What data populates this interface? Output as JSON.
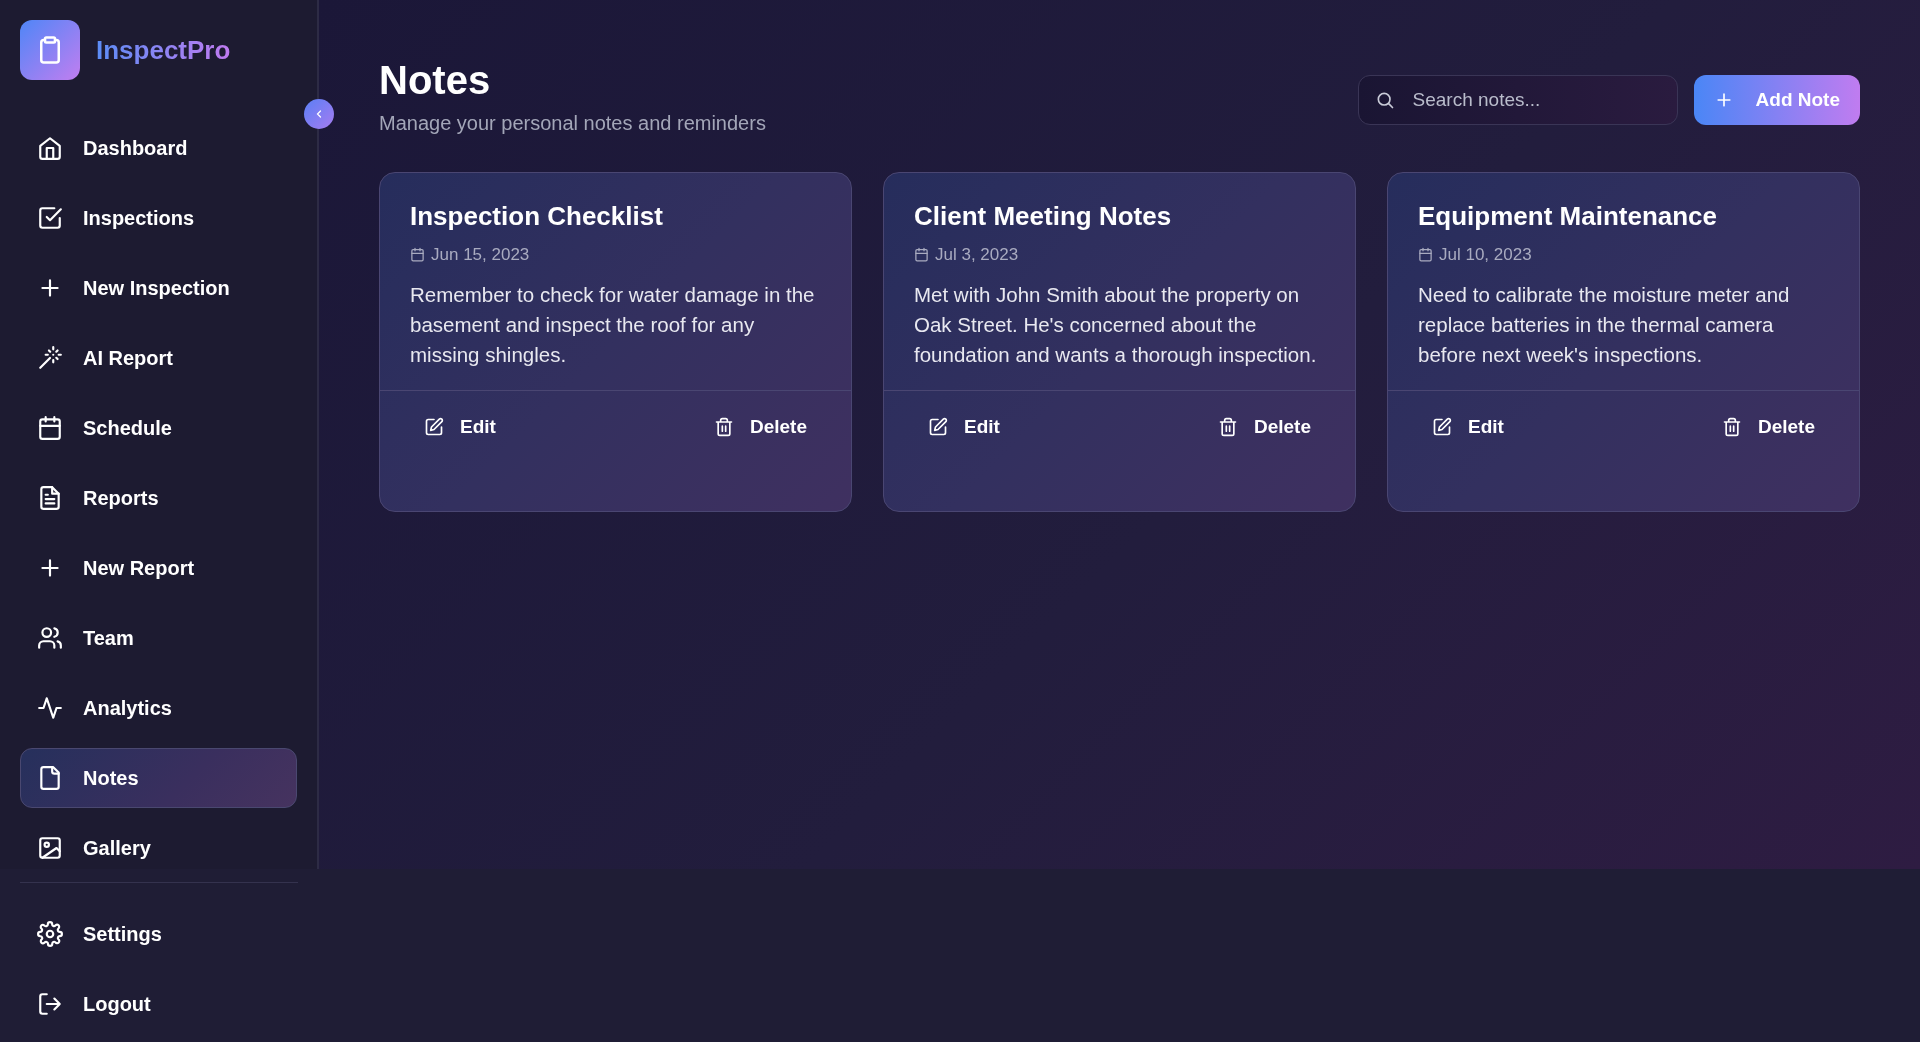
{
  "brand": {
    "name": "InspectPro"
  },
  "sidebar": {
    "items": [
      {
        "label": "Dashboard",
        "selected": false
      },
      {
        "label": "Inspections",
        "selected": false
      },
      {
        "label": "New Inspection",
        "selected": false
      },
      {
        "label": "AI Report",
        "selected": false
      },
      {
        "label": "Schedule",
        "selected": false
      },
      {
        "label": "Reports",
        "selected": false
      },
      {
        "label": "New Report",
        "selected": false
      },
      {
        "label": "Team",
        "selected": false
      },
      {
        "label": "Analytics",
        "selected": false
      },
      {
        "label": "Notes",
        "selected": true
      },
      {
        "label": "Gallery",
        "selected": false
      }
    ],
    "footer_items": [
      {
        "label": "Settings"
      },
      {
        "label": "Logout"
      }
    ]
  },
  "header": {
    "title": "Notes",
    "subtitle": "Manage your personal notes and reminders",
    "search": {
      "placeholder": "Search notes..."
    },
    "add_button": "Add Note"
  },
  "notes": [
    {
      "title": "Inspection Checklist",
      "date": "Jun 15, 2023",
      "body": "Remember to check for water damage in the basement and inspect the roof for any missing shingles.",
      "actions": [
        "Edit",
        "Delete"
      ]
    },
    {
      "title": "Client Meeting Notes",
      "date": "Jul 3, 2023",
      "body": "Met with John Smith about the property on Oak Street. He's concerned about the foundation and wants a thorough inspection.",
      "actions": [
        "Edit",
        "Delete"
      ]
    },
    {
      "title": "Equipment Maintenance",
      "date": "Jul 10, 2023",
      "body": "Need to calibrate the moisture meter and replace batteries in the thermal camera before next week's inspections.",
      "actions": [
        "Edit",
        "Delete"
      ]
    }
  ]
}
